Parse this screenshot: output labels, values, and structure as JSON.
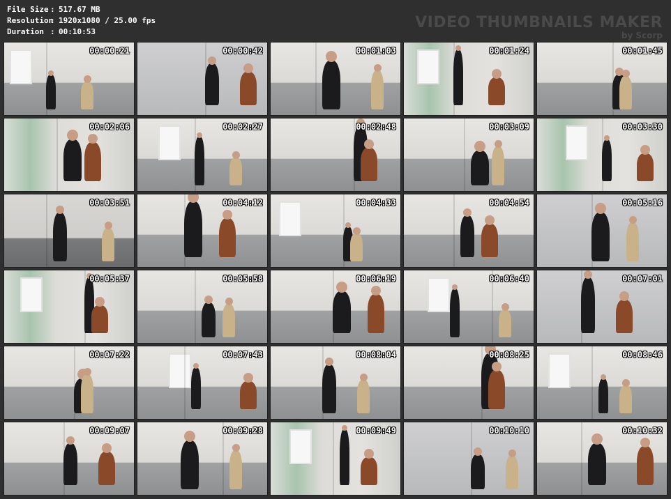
{
  "info": {
    "file_size_label": "File Size",
    "file_size_value": "517.67 MB",
    "resolution_label": "Resolution",
    "resolution_value": "1920x1080 / 25.00 fps",
    "duration_label": "Duration",
    "duration_value": "00:10:53",
    "separator": ":"
  },
  "brand": {
    "title": "VIDEO THUMBNAILS MAKER",
    "by": "by Scorp"
  },
  "thumbnails": [
    {
      "time": "00:00:21"
    },
    {
      "time": "00:00:42"
    },
    {
      "time": "00:01:03"
    },
    {
      "time": "00:01:24"
    },
    {
      "time": "00:01:45"
    },
    {
      "time": "00:02:06"
    },
    {
      "time": "00:02:27"
    },
    {
      "time": "00:02:48"
    },
    {
      "time": "00:03:09"
    },
    {
      "time": "00:03:30"
    },
    {
      "time": "00:03:51"
    },
    {
      "time": "00:04:12"
    },
    {
      "time": "00:04:33"
    },
    {
      "time": "00:04:54"
    },
    {
      "time": "00:05:16"
    },
    {
      "time": "00:05:37"
    },
    {
      "time": "00:05:58"
    },
    {
      "time": "00:06:19"
    },
    {
      "time": "00:06:40"
    },
    {
      "time": "00:07:01"
    },
    {
      "time": "00:07:22"
    },
    {
      "time": "00:07:43"
    },
    {
      "time": "00:08:04"
    },
    {
      "time": "00:08:25"
    },
    {
      "time": "00:08:46"
    },
    {
      "time": "00:09:07"
    },
    {
      "time": "00:09:28"
    },
    {
      "time": "00:09:49"
    },
    {
      "time": "00:10:10"
    },
    {
      "time": "00:10:32"
    }
  ]
}
